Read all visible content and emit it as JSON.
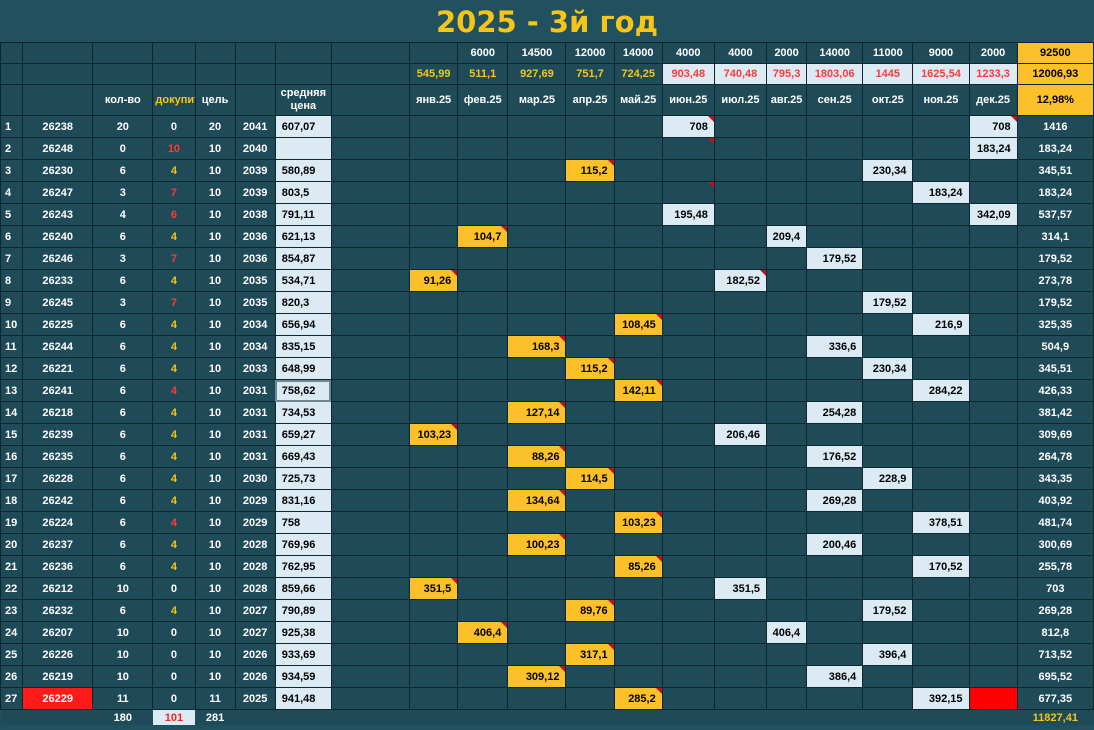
{
  "title": "2025 - 3й год",
  "headers": {
    "qty": "кол-во",
    "buy": "докупить",
    "goal": "цель",
    "avg_price": "средняя цена",
    "months": [
      "янв.25",
      "фев.25",
      "мар.25",
      "апр.25",
      "май.25",
      "июн.25",
      "июл.25",
      "авг.25",
      "сен.25",
      "окт.25",
      "ноя.25",
      "дек.25"
    ],
    "percent": "12,98%"
  },
  "plan_row": [
    "",
    "6000",
    "14500",
    "12000",
    "14000",
    "4000",
    "4000",
    "2000",
    "14000",
    "11000",
    "9000",
    "2000"
  ],
  "plan_total": "92500",
  "spent_row": [
    "545,99",
    "511,1",
    "927,69",
    "751,7",
    "724,25",
    "903,48",
    "740,48",
    "795,3",
    "1803,06",
    "1445",
    "1625,54",
    "1233,3"
  ],
  "spent_total": "12006,93",
  "colors": {
    "bg": "#21505e",
    "month_cell": "#2f8196",
    "highlight": "#fbc02a",
    "light": "#dceaf4",
    "accent_text": "#f5c518",
    "alert": "#ff0000"
  },
  "rows": [
    {
      "n": "1",
      "code": "26238",
      "qty": "20",
      "buy": "0",
      "goal": "20",
      "year": "2041",
      "price": "607,07",
      "m": {
        "5": [
          "708",
          "w"
        ],
        "11": [
          "708",
          "w"
        ]
      },
      "sum": "1416"
    },
    {
      "n": "2",
      "code": "26248",
      "qty": "0",
      "buy": "10",
      "goal": "10",
      "year": "2040",
      "price": "",
      "m": {
        "11": [
          "183,24",
          "w"
        ]
      },
      "sum": "183,24"
    },
    {
      "n": "3",
      "code": "26230",
      "qty": "6",
      "buy": "4",
      "goal": "10",
      "year": "2039",
      "price": "580,89",
      "m": {
        "3": [
          "115,2",
          "y"
        ],
        "9": [
          "230,34",
          "w"
        ]
      },
      "sum": "345,51"
    },
    {
      "n": "4",
      "code": "26247",
      "qty": "3",
      "buy": "7",
      "goal": "10",
      "year": "2039",
      "price": "803,5",
      "m": {
        "10": [
          "183,24",
          "w"
        ]
      },
      "sum": "183,24"
    },
    {
      "n": "5",
      "code": "26243",
      "qty": "4",
      "buy": "6",
      "goal": "10",
      "year": "2038",
      "price": "791,11",
      "m": {
        "5": [
          "195,48",
          "w"
        ],
        "11": [
          "342,09",
          "w"
        ]
      },
      "sum": "537,57"
    },
    {
      "n": "6",
      "code": "26240",
      "qty": "6",
      "buy": "4",
      "goal": "10",
      "year": "2036",
      "price": "621,13",
      "m": {
        "1": [
          "104,7",
          "y"
        ],
        "7": [
          "209,4",
          "w"
        ]
      },
      "sum": "314,1"
    },
    {
      "n": "7",
      "code": "26246",
      "qty": "3",
      "buy": "7",
      "goal": "10",
      "year": "2036",
      "price": "854,87",
      "m": {
        "8": [
          "179,52",
          "w"
        ]
      },
      "sum": "179,52"
    },
    {
      "n": "8",
      "code": "26233",
      "qty": "6",
      "buy": "4",
      "goal": "10",
      "year": "2035",
      "price": "534,71",
      "m": {
        "0": [
          "91,26",
          "y"
        ],
        "6": [
          "182,52",
          "w"
        ]
      },
      "sum": "273,78"
    },
    {
      "n": "9",
      "code": "26245",
      "qty": "3",
      "buy": "7",
      "goal": "10",
      "year": "2035",
      "price": "820,3",
      "m": {
        "9": [
          "179,52",
          "w"
        ]
      },
      "sum": "179,52"
    },
    {
      "n": "10",
      "code": "26225",
      "qty": "6",
      "buy": "4",
      "goal": "10",
      "year": "2034",
      "price": "656,94",
      "m": {
        "4": [
          "108,45",
          "y"
        ],
        "10": [
          "216,9",
          "w"
        ]
      },
      "sum": "325,35"
    },
    {
      "n": "11",
      "code": "26244",
      "qty": "6",
      "buy": "4",
      "goal": "10",
      "year": "2034",
      "price": "835,15",
      "m": {
        "2": [
          "168,3",
          "y"
        ],
        "8": [
          "336,6",
          "w"
        ]
      },
      "sum": "504,9"
    },
    {
      "n": "12",
      "code": "26221",
      "qty": "6",
      "buy": "4",
      "goal": "10",
      "year": "2033",
      "price": "648,99",
      "m": {
        "3": [
          "115,2",
          "y"
        ],
        "9": [
          "230,34",
          "w"
        ]
      },
      "sum": "345,51"
    },
    {
      "n": "13",
      "code": "26241",
      "qty": "6",
      "buy": "4",
      "goal": "10",
      "year": "2031",
      "price": "758,62",
      "m": {
        "4": [
          "142,11",
          "y"
        ],
        "10": [
          "284,22",
          "w"
        ]
      },
      "sum": "426,33"
    },
    {
      "n": "14",
      "code": "26218",
      "qty": "6",
      "buy": "4",
      "goal": "10",
      "year": "2031",
      "price": "734,53",
      "m": {
        "2": [
          "127,14",
          "y"
        ],
        "8": [
          "254,28",
          "w"
        ]
      },
      "sum": "381,42"
    },
    {
      "n": "15",
      "code": "26239",
      "qty": "6",
      "buy": "4",
      "goal": "10",
      "year": "2031",
      "price": "659,27",
      "m": {
        "0": [
          "103,23",
          "y"
        ],
        "6": [
          "206,46",
          "w"
        ]
      },
      "sum": "309,69"
    },
    {
      "n": "16",
      "code": "26235",
      "qty": "6",
      "buy": "4",
      "goal": "10",
      "year": "2031",
      "price": "669,43",
      "m": {
        "2": [
          "88,26",
          "y"
        ],
        "8": [
          "176,52",
          "w"
        ]
      },
      "sum": "264,78"
    },
    {
      "n": "17",
      "code": "26228",
      "qty": "6",
      "buy": "4",
      "goal": "10",
      "year": "2030",
      "price": "725,73",
      "m": {
        "3": [
          "114,5",
          "y"
        ],
        "9": [
          "228,9",
          "w"
        ]
      },
      "sum": "343,35"
    },
    {
      "n": "18",
      "code": "26242",
      "qty": "6",
      "buy": "4",
      "goal": "10",
      "year": "2029",
      "price": "831,16",
      "m": {
        "2": [
          "134,64",
          "y"
        ],
        "8": [
          "269,28",
          "w"
        ]
      },
      "sum": "403,92"
    },
    {
      "n": "19",
      "code": "26224",
      "qty": "6",
      "buy": "4",
      "goal": "10",
      "year": "2029",
      "price": "758",
      "m": {
        "4": [
          "103,23",
          "y"
        ],
        "10": [
          "378,51",
          "w"
        ]
      },
      "sum": "481,74"
    },
    {
      "n": "20",
      "code": "26237",
      "qty": "6",
      "buy": "4",
      "goal": "10",
      "year": "2028",
      "price": "769,96",
      "m": {
        "2": [
          "100,23",
          "y"
        ],
        "8": [
          "200,46",
          "w"
        ]
      },
      "sum": "300,69"
    },
    {
      "n": "21",
      "code": "26236",
      "qty": "6",
      "buy": "4",
      "goal": "10",
      "year": "2028",
      "price": "762,95",
      "m": {
        "4": [
          "85,26",
          "y"
        ],
        "10": [
          "170,52",
          "w"
        ]
      },
      "sum": "255,78"
    },
    {
      "n": "22",
      "code": "26212",
      "qty": "10",
      "buy": "0",
      "goal": "10",
      "year": "2028",
      "price": "859,66",
      "m": {
        "0": [
          "351,5",
          "y"
        ],
        "6": [
          "351,5",
          "w"
        ]
      },
      "sum": "703"
    },
    {
      "n": "23",
      "code": "26232",
      "qty": "6",
      "buy": "4",
      "goal": "10",
      "year": "2027",
      "price": "790,89",
      "m": {
        "3": [
          "89,76",
          "y"
        ],
        "9": [
          "179,52",
          "w"
        ]
      },
      "sum": "269,28"
    },
    {
      "n": "24",
      "code": "26207",
      "qty": "10",
      "buy": "0",
      "goal": "10",
      "year": "2027",
      "price": "925,38",
      "m": {
        "1": [
          "406,4",
          "y"
        ],
        "7": [
          "406,4",
          "w"
        ]
      },
      "sum": "812,8"
    },
    {
      "n": "25",
      "code": "26226",
      "qty": "10",
      "buy": "0",
      "goal": "10",
      "year": "2026",
      "price": "933,69",
      "m": {
        "3": [
          "317,1",
          "y"
        ],
        "9": [
          "396,4",
          "w"
        ]
      },
      "sum": "713,52"
    },
    {
      "n": "26",
      "code": "26219",
      "qty": "10",
      "buy": "0",
      "goal": "10",
      "year": "2026",
      "price": "934,59",
      "m": {
        "2": [
          "309,12",
          "y"
        ],
        "8": [
          "386,4",
          "w"
        ]
      },
      "sum": "695,52"
    },
    {
      "n": "27",
      "code": "26229",
      "qty": "11",
      "buy": "0",
      "goal": "11",
      "year": "2025",
      "price": "941,48",
      "m": {
        "4": [
          "285,2",
          "y"
        ],
        "10": [
          "392,15",
          "w"
        ],
        "11": [
          "",
          "r"
        ]
      },
      "sum": "677,35"
    }
  ],
  "totals": {
    "qty": "180",
    "buy": "101",
    "goal": "281",
    "sum": "11827,41"
  }
}
